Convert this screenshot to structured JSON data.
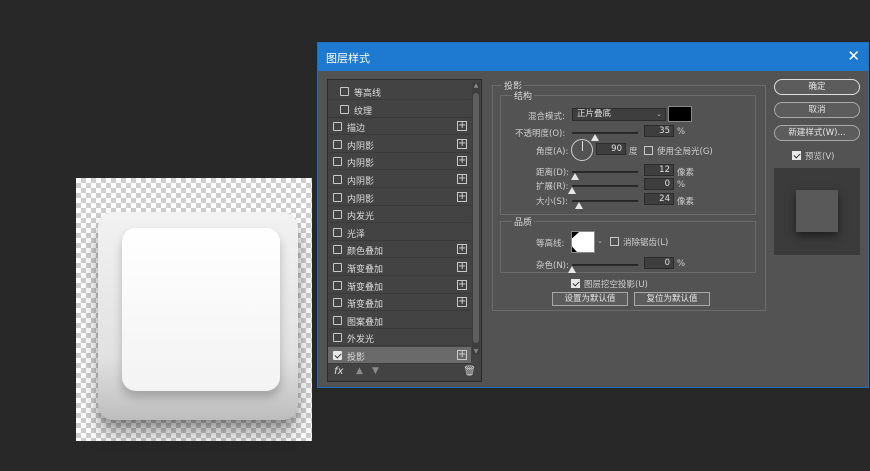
{
  "dialog": {
    "title": "图层样式"
  },
  "styles_list": {
    "items": [
      {
        "label": "等高线",
        "checked": false,
        "plus": false,
        "indent": true
      },
      {
        "label": "纹理",
        "checked": false,
        "plus": false,
        "indent": true
      },
      {
        "label": "描边",
        "checked": false,
        "plus": true,
        "indent": false
      },
      {
        "label": "内阴影",
        "checked": false,
        "plus": true,
        "indent": false
      },
      {
        "label": "内阴影",
        "checked": false,
        "plus": true,
        "indent": false
      },
      {
        "label": "内阴影",
        "checked": false,
        "plus": true,
        "indent": false
      },
      {
        "label": "内阴影",
        "checked": false,
        "plus": true,
        "indent": false
      },
      {
        "label": "内发光",
        "checked": false,
        "plus": false,
        "indent": false
      },
      {
        "label": "光泽",
        "checked": false,
        "plus": false,
        "indent": false
      },
      {
        "label": "颜色叠加",
        "checked": false,
        "plus": true,
        "indent": false
      },
      {
        "label": "渐变叠加",
        "checked": false,
        "plus": true,
        "indent": false
      },
      {
        "label": "渐变叠加",
        "checked": false,
        "plus": true,
        "indent": false
      },
      {
        "label": "渐变叠加",
        "checked": false,
        "plus": true,
        "indent": false
      },
      {
        "label": "图案叠加",
        "checked": false,
        "plus": false,
        "indent": false
      },
      {
        "label": "外发光",
        "checked": false,
        "plus": false,
        "indent": false
      },
      {
        "label": "投影",
        "checked": true,
        "plus": true,
        "indent": false,
        "selected": true
      }
    ],
    "footer_fx": "fx"
  },
  "shadow": {
    "title": "投影",
    "structure": {
      "title": "结构",
      "blend_mode_label": "混合模式:",
      "blend_mode_value": "正片叠底",
      "shadow_color": "#000000",
      "opacity_label": "不透明度(O):",
      "opacity_value": "35",
      "opacity_unit": "%",
      "opacity_fraction": 0.35,
      "angle_label": "角度(A):",
      "angle_value": "90",
      "angle_unit": "度",
      "global_light_label": "使用全局光(G)",
      "global_light_checked": false,
      "distance_label": "距离(D):",
      "distance_value": "12",
      "distance_unit": "像素",
      "distance_fraction": 0.04,
      "spread_label": "扩展(R):",
      "spread_value": "0",
      "spread_unit": "%",
      "spread_fraction": 0.0,
      "size_label": "大小(S):",
      "size_value": "24",
      "size_unit": "像素",
      "size_fraction": 0.1
    },
    "quality": {
      "title": "品质",
      "contour_label": "等高线:",
      "anti_alias_label": "消除锯齿(L)",
      "anti_alias_checked": false,
      "noise_label": "杂色(N):",
      "noise_value": "0",
      "noise_unit": "%",
      "noise_fraction": 0.0
    },
    "knockout_label": "图层挖空投影(U)",
    "knockout_checked": true,
    "set_default_label": "设置为默认值",
    "reset_default_label": "复位为默认值"
  },
  "side_buttons": {
    "ok": "确定",
    "cancel": "取消",
    "new_style": "新建样式(W)...",
    "preview_label": "预览(V)",
    "preview_checked": true
  }
}
